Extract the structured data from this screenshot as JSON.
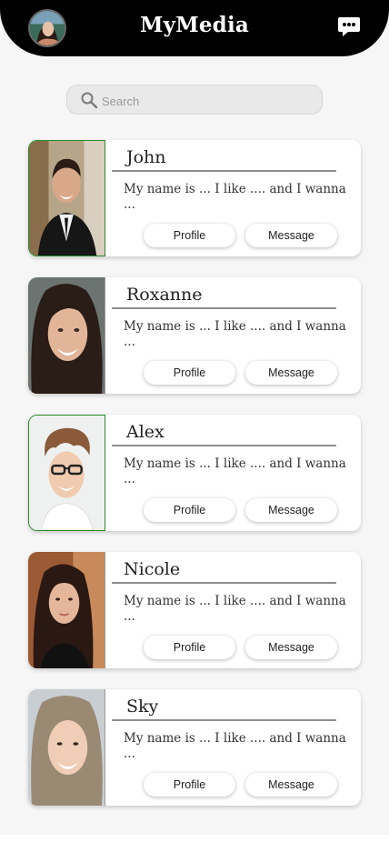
{
  "app": {
    "title": "MyMedia",
    "background": "#f6f6f6",
    "header_color": "#000000"
  },
  "search": {
    "placeholder": "Search",
    "value": ""
  },
  "status_colors": {
    "online": "#2c8a2c",
    "offline": "#9a9a9a"
  },
  "contacts": [
    {
      "name": "John",
      "bio": "My name is ... I like .... and I wanna ...",
      "profile_label": "Profile",
      "message_label": "Message",
      "status": "online"
    },
    {
      "name": "Roxanne",
      "bio": "My name is ... I like .... and I wanna ...",
      "profile_label": "Profile",
      "message_label": "Message",
      "status": "offline"
    },
    {
      "name": "Alex",
      "bio": "My name is ... I like .... and I wanna ...",
      "profile_label": "Profile",
      "message_label": "Message",
      "status": "online"
    },
    {
      "name": "Nicole",
      "bio": "My name is ... I like .... and I wanna ...",
      "profile_label": "Profile",
      "message_label": "Message",
      "status": "offline"
    },
    {
      "name": "Sky",
      "bio": "My name is ... I like .... and I wanna ...",
      "profile_label": "Profile",
      "message_label": "Message",
      "status": "offline"
    }
  ],
  "icons": {
    "chat": "chat-bubble-icon",
    "search": "search-icon"
  }
}
